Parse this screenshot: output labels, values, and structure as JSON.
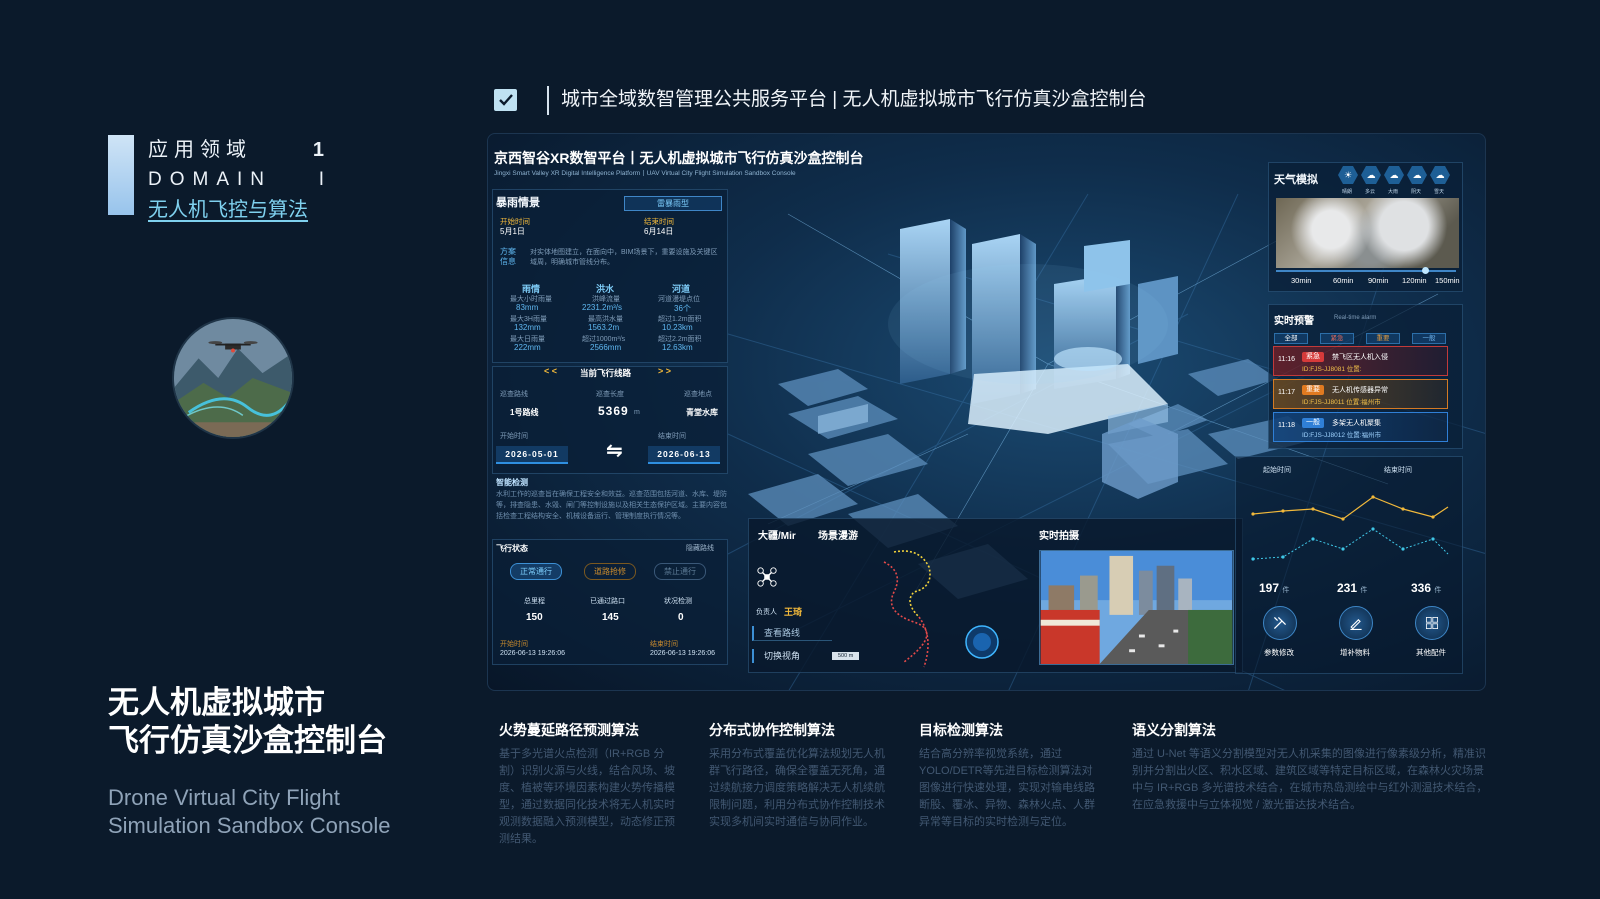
{
  "sidebar": {
    "domain_cn": "应用领域",
    "domain_num": "1",
    "domain_en": "DOMAIN",
    "domain_roman": "I",
    "domain_link": "无人机飞控与算法"
  },
  "hero": {
    "title_line1": "无人机虚拟城市",
    "title_line2": "飞行仿真沙盒控制台",
    "subtitle_line1": "Drone Virtual City Flight",
    "subtitle_line2": "Simulation Sandbox Console"
  },
  "header": {
    "title": "城市全域数智管理公共服务平台 | 无人机虚拟城市飞行仿真沙盒控制台"
  },
  "console": {
    "title": "京西智谷XR数智平台丨无人机虚拟城市飞行仿真沙盒控制台",
    "subtitle_en": "Jingxi Smart Valley XR Digital Intelligence Platform丨UAV Virtual City Flight Simulation Sandbox Console",
    "storm": {
      "title": "暴雨情景",
      "tag": "雷暴雨型",
      "start_label": "开始时间",
      "start_value": "5月1日",
      "end_label": "结束时间",
      "end_value": "6月14日",
      "plan_label": "方案信息",
      "plan_text": "对实体地图建立，在面向中，BIM场景下，重要设施及关键区域周，明确城市管线分布。",
      "cols": [
        {
          "head": "雨情",
          "r1_label": "最大小时雨量",
          "r1_value": "83mm",
          "r2_label": "最大3H雨量",
          "r2_value": "132mm",
          "r3_label": "最大日雨量",
          "r3_value": "222mm"
        },
        {
          "head": "洪水",
          "r1_label": "洪峰流量",
          "r1_value": "2231.2m³/s",
          "r2_label": "最高洪水量",
          "r2_value": "1563.2m",
          "r3_label": "超过1000m³/s",
          "r3_value": "2566mm"
        },
        {
          "head": "河道",
          "r1_label": "河道漫堤点位",
          "r1_value": "36个",
          "r2_label": "超过1.2m面积",
          "r2_value": "10.23km",
          "r3_label": "超过2.2m面积",
          "r3_value": "12.63km"
        }
      ]
    },
    "route": {
      "title": "当前飞行线路",
      "k1_label": "巡查路线",
      "k1_value": "1号路线",
      "k2_label": "巡查长度",
      "k2_value": "5369",
      "k2_unit": "m",
      "k3_label": "巡查地点",
      "k3_value": "青堂水库",
      "start_label": "开始时间",
      "start_value": "2026-05-01",
      "end_label": "结束时间",
      "end_value": "2026-06-13",
      "swap_icon": "⇋"
    },
    "smart": {
      "title": "智能检测",
      "text": "水利工作的巡查旨在确保工程安全和效益。巡查范围包括河道、水库、堤防等，排查隐患、水毁、闸门等控制设施以及相关生态保护区域。主要内容包括检查工程结构安全、机械设备运行、管理制度执行情况等。"
    },
    "flight": {
      "title": "飞行状态",
      "hide": "隐藏路线",
      "b1": "正常通行",
      "b2": "道路抢修",
      "b3": "禁止通行",
      "c1_label": "总里程",
      "c1_value": "150",
      "c2_label": "已通过路口",
      "c2_value": "145",
      "c3_label": "状况检测",
      "c3_value": "0",
      "s_label": "开始时间",
      "s_value": "2026-06-13 19:26:06",
      "e_label": "结束时间",
      "e_value": "2026-06-13 19:26:06"
    },
    "drone": {
      "title": "大疆/Mir",
      "subtitle": "场景漫游",
      "owner_label": "负责人",
      "owner_name": "王琦",
      "btn_route": "查看路线",
      "btn_view": "切换视角",
      "scale": "500 m"
    },
    "live": {
      "title": "实时拍摄"
    },
    "weather": {
      "title": "天气模拟",
      "icons": [
        {
          "glyph": "☀",
          "label": "晴朗"
        },
        {
          "glyph": "☁",
          "label": "多云"
        },
        {
          "glyph": "☁",
          "label": "大雨"
        },
        {
          "glyph": "☁",
          "label": "阴天"
        },
        {
          "glyph": "☁",
          "label": "雪天"
        }
      ],
      "times": [
        "30min",
        "60min",
        "90min",
        "120min",
        "150min"
      ]
    },
    "alarm": {
      "title": "实时预警",
      "title_en": "Real-time alarm",
      "tabs": [
        "全部",
        "紧急",
        "重要",
        "一般"
      ],
      "items": [
        {
          "time": "11:16",
          "badge": "紧急",
          "msg": "禁飞区无人机入侵",
          "id": "ID:FJS-JJ8081 位置:"
        },
        {
          "time": "11:17",
          "badge": "重要",
          "msg": "无人机传感器异常",
          "id": "ID:FJS-JJ8011 位置:福州市"
        },
        {
          "time": "11:18",
          "badge": "一般",
          "msg": "多架无人机聚集",
          "id": "ID:FJS-JJ8012 位置:福州市"
        }
      ]
    },
    "stats": {
      "start_label": "起始时间",
      "end_label": "结束时间",
      "counts": [
        {
          "value": "197",
          "unit": "件",
          "label": "参数修改"
        },
        {
          "value": "231",
          "unit": "件",
          "label": "增补物料"
        },
        {
          "value": "336",
          "unit": "件",
          "label": "其他配件"
        }
      ]
    },
    "colors": {
      "accent": "#2f8fe0",
      "urgent": "#d63a3a",
      "important": "#e07a20",
      "normal": "#2f7fd6",
      "chart_line": "#f2b93b"
    }
  },
  "algorithms": [
    {
      "title": "火势蔓延路径预测算法",
      "desc": "基于多光谱火点检测（IR+RGB 分割）识别火源与火线，结合风场、坡度、植被等环境因素构建火势传播模型，通过数据同化技术将无人机实时观测数据融入预测模型，动态修正预测结果。"
    },
    {
      "title": "分布式协作控制算法",
      "desc": "采用分布式覆盖优化算法规划无人机群飞行路径，确保全覆盖无死角，通过续航接力调度策略解决无人机续航限制问题，利用分布式协作控制技术实现多机间实时通信与协同作业。"
    },
    {
      "title": "目标检测算法",
      "desc": "结合高分辨率视觉系统，通过YOLO/DETR等先进目标检测算法对图像进行快速处理，实现对输电线路断股、覆冰、异物、森林火点、人群异常等目标的实时检测与定位。"
    },
    {
      "title": "语义分割算法",
      "desc": "通过 U-Net 等语义分割模型对无人机采集的图像进行像素级分析，精准识别并分割出火区、积水区域、建筑区域等特定目标区域，在森林火灾场景中与 IR+RGB 多光谱技术结合，在城市热岛测绘中与红外测温技术结合，在应急救援中与立体视觉 / 激光雷达技术结合。"
    }
  ]
}
